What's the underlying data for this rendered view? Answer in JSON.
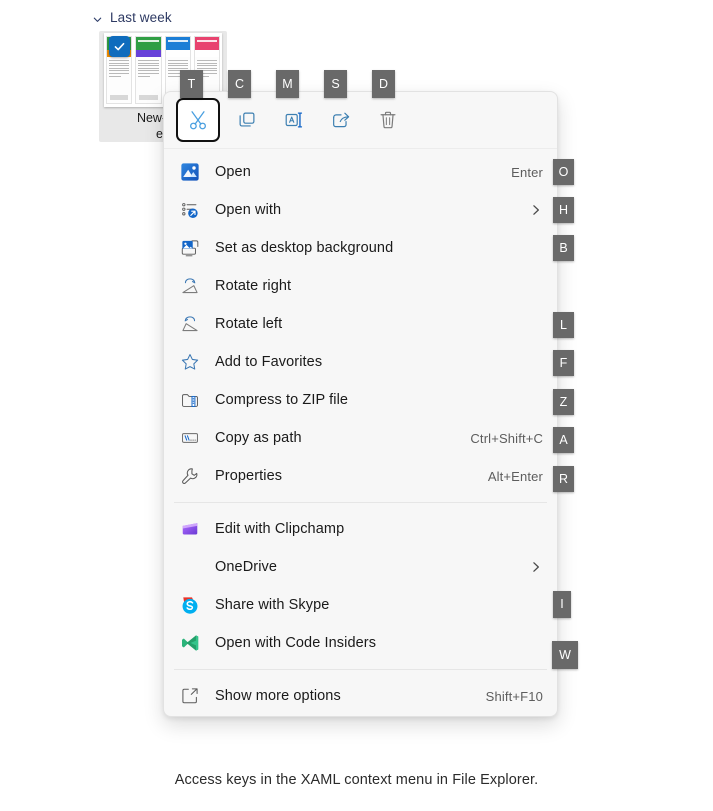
{
  "explorer": {
    "group_label": "Last week",
    "group_chevron_icon": "chevron-down-icon",
    "file_name_line1": "New-Cha",
    "file_name_line2": "en",
    "selected_check_icon": "check-icon"
  },
  "command_bar": {
    "buttons": [
      {
        "name": "cut",
        "label": "Cut",
        "icon": "scissors-icon",
        "access_key": "T",
        "focused": true
      },
      {
        "name": "copy",
        "label": "Copy",
        "icon": "copy-icon",
        "access_key": "C",
        "focused": false
      },
      {
        "name": "rename",
        "label": "Rename",
        "icon": "rename-icon",
        "access_key": "M",
        "focused": false
      },
      {
        "name": "share",
        "label": "Share",
        "icon": "share-icon",
        "access_key": "S",
        "focused": false
      },
      {
        "name": "delete",
        "label": "Delete",
        "icon": "trash-icon",
        "access_key": "D",
        "focused": false
      }
    ]
  },
  "context_menu": {
    "sections": [
      {
        "items": [
          {
            "label": "Open",
            "icon": "photos-app-icon",
            "accelerator": "Enter",
            "access_key": "O",
            "submenu": false
          },
          {
            "label": "Open with",
            "icon": "open-with-icon",
            "accelerator": "",
            "access_key": "H",
            "submenu": true
          },
          {
            "label": "Set as desktop background",
            "icon": "desktop-background-icon",
            "accelerator": "",
            "access_key": "B",
            "submenu": false
          },
          {
            "label": "Rotate right",
            "icon": "rotate-right-icon",
            "accelerator": "",
            "access_key": "",
            "submenu": false
          },
          {
            "label": "Rotate left",
            "icon": "rotate-left-icon",
            "accelerator": "",
            "access_key": "L",
            "submenu": false
          },
          {
            "label": "Add to Favorites",
            "icon": "star-icon",
            "accelerator": "",
            "access_key": "F",
            "submenu": false
          },
          {
            "label": "Compress to ZIP file",
            "icon": "zip-icon",
            "accelerator": "",
            "access_key": "Z",
            "submenu": false
          },
          {
            "label": "Copy as path",
            "icon": "copy-as-path-icon",
            "accelerator": "Ctrl+Shift+C",
            "access_key": "A",
            "submenu": false
          },
          {
            "label": "Properties",
            "icon": "wrench-icon",
            "accelerator": "Alt+Enter",
            "access_key": "R",
            "submenu": false
          }
        ]
      },
      {
        "items": [
          {
            "label": "Edit with Clipchamp",
            "icon": "clipchamp-icon",
            "accelerator": "",
            "access_key": "",
            "submenu": false
          },
          {
            "label": "OneDrive",
            "icon": "",
            "accelerator": "",
            "access_key": "",
            "submenu": true
          },
          {
            "label": "Share with Skype",
            "icon": "skype-icon",
            "accelerator": "",
            "access_key": "I",
            "submenu": false
          },
          {
            "label": "Open with Code Insiders",
            "icon": "vscode-insiders-icon",
            "accelerator": "",
            "access_key": "W",
            "submenu": false
          }
        ]
      },
      {
        "items": [
          {
            "label": "Show more options",
            "icon": "show-more-options-icon",
            "accelerator": "Shift+F10",
            "access_key": "",
            "submenu": false
          }
        ]
      }
    ]
  },
  "caption": "Access keys in the XAML context menu in File Explorer.",
  "colors": {
    "accent_blue": "#0f6cbd",
    "badge_gray": "#696969",
    "menu_bg": "#f7f7f7",
    "text": "#1a1a1a",
    "group_header": "#2e3a63"
  }
}
